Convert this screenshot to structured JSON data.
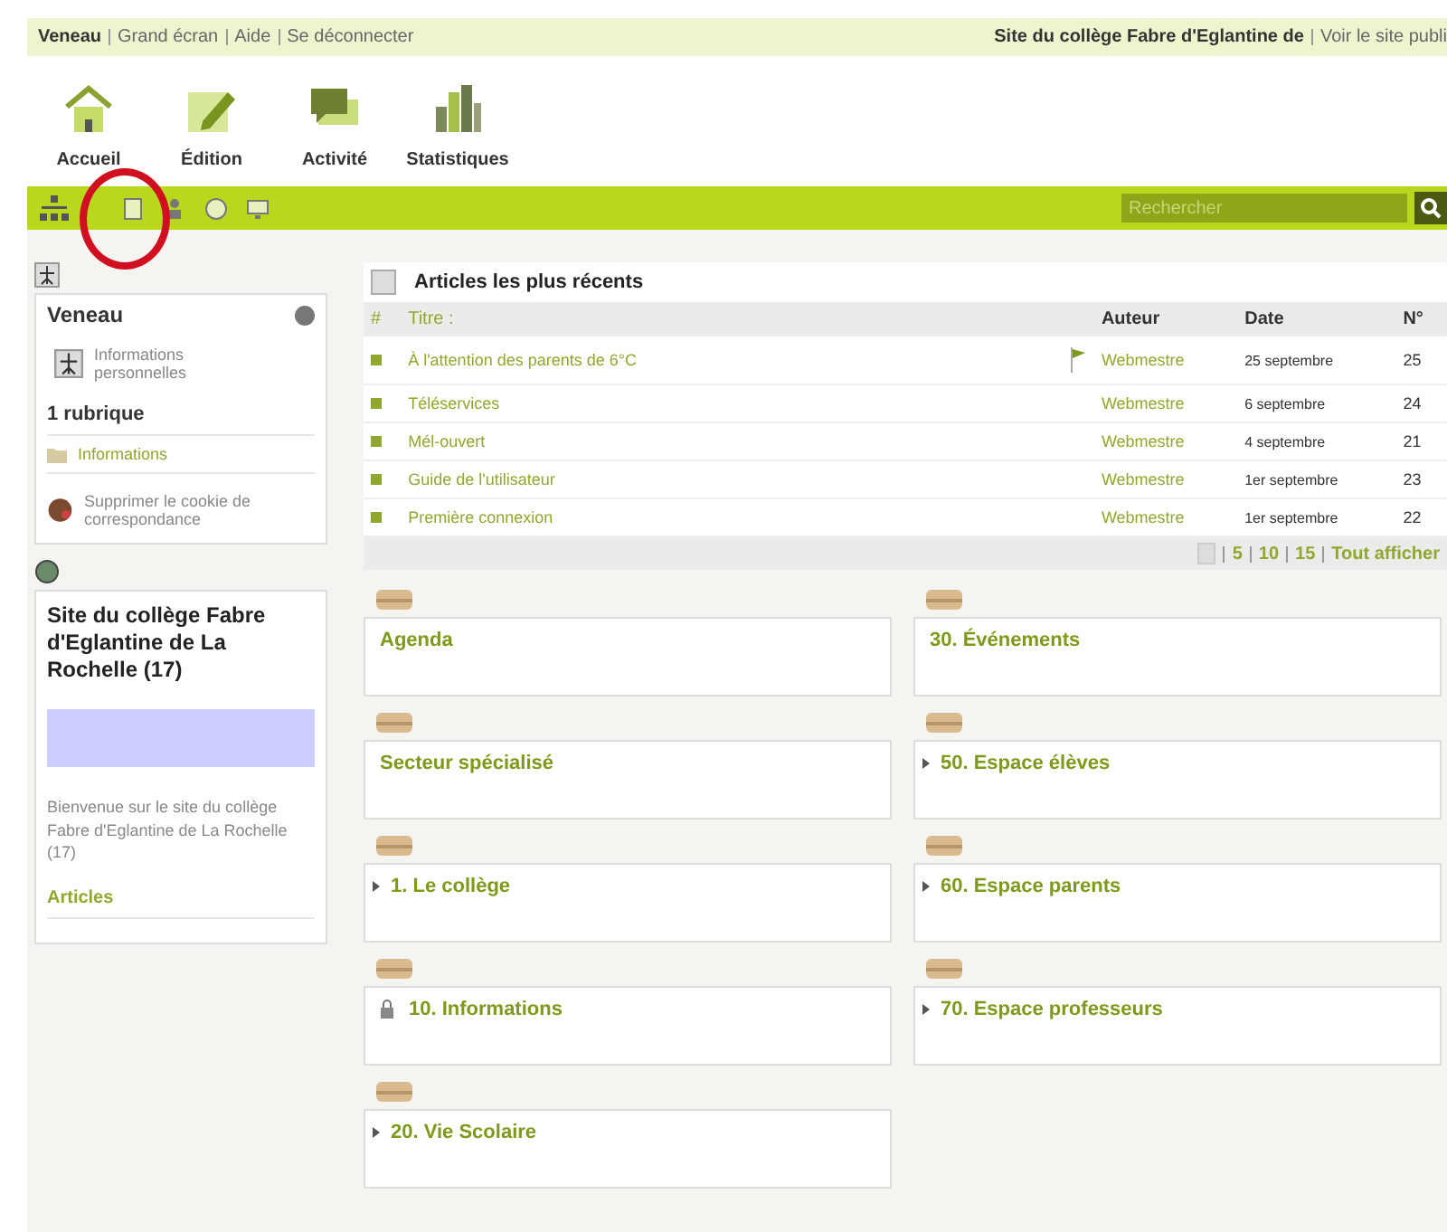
{
  "top_bar": {
    "links": [
      "Veneau",
      "Grand écran",
      "Aide",
      "Se déconnecter"
    ],
    "site_title": "Site du collège Fabre d'Eglantine de",
    "site_link": "Voir le site publi"
  },
  "nav": [
    {
      "label": "Accueil",
      "kind": "home"
    },
    {
      "label": "Édition",
      "kind": "edit"
    },
    {
      "label": "Activité",
      "kind": "chat"
    },
    {
      "label": "Statistiques",
      "kind": "stats"
    }
  ],
  "toolbar": {
    "search": {
      "placeholder": "Rechercher"
    }
  },
  "annotation": {
    "kind": "circle"
  },
  "profile": {
    "name": "Veneau",
    "personal_info": "Informations personnelles",
    "rubrique_count": "1 rubrique",
    "rubrique": "Informations",
    "cookie": "Supprimer le cookie de correspondance"
  },
  "site": {
    "title": "Site du collège Fabre d'Eglantine de La Rochelle (17)",
    "welcome": "Bienvenue sur le site du collège Fabre d'Eglantine de La Rochelle (17)",
    "articles": "Articles"
  },
  "recent": {
    "title": "Articles les plus récents",
    "columns": [
      "#",
      "Titre :",
      "Auteur",
      "Date",
      "N°"
    ],
    "rows": [
      {
        "title": "À l'attention des parents de 6°C",
        "author": "Webmestre",
        "date": "25 septembre",
        "number": "25",
        "has_icon": true
      },
      {
        "title": "Téléservices",
        "author": "Webmestre",
        "date": "6 septembre",
        "number": "24",
        "has_icon": false
      },
      {
        "title": "Mél-ouvert",
        "author": "Webmestre",
        "date": "4 septembre",
        "number": "21",
        "has_icon": false
      },
      {
        "title": "Guide de l'utilisateur",
        "author": "Webmestre",
        "date": "1er septembre",
        "number": "23",
        "has_icon": false
      },
      {
        "title": "Première connexion",
        "author": "Webmestre",
        "date": "1er septembre",
        "number": "22",
        "has_icon": false
      }
    ],
    "pagination": [
      "5",
      "10",
      "15",
      "Tout afficher"
    ]
  },
  "blocks": [
    [
      {
        "title": "Agenda",
        "expandable": false,
        "locked": false
      },
      {
        "title": "Secteur spécialisé",
        "expandable": false,
        "locked": false
      },
      {
        "title": "1. Le collège",
        "expandable": true,
        "locked": false
      },
      {
        "title": "10. Informations",
        "expandable": false,
        "locked": true
      },
      {
        "title": "20. Vie Scolaire",
        "expandable": true,
        "locked": false
      }
    ],
    [
      {
        "title": "30. Événements",
        "expandable": false,
        "locked": false
      },
      {
        "title": "50. Espace élèves",
        "expandable": true,
        "locked": false
      },
      {
        "title": "60. Espace parents",
        "expandable": true,
        "locked": false
      },
      {
        "title": "70. Espace professeurs",
        "expandable": true,
        "locked": false
      }
    ]
  ]
}
